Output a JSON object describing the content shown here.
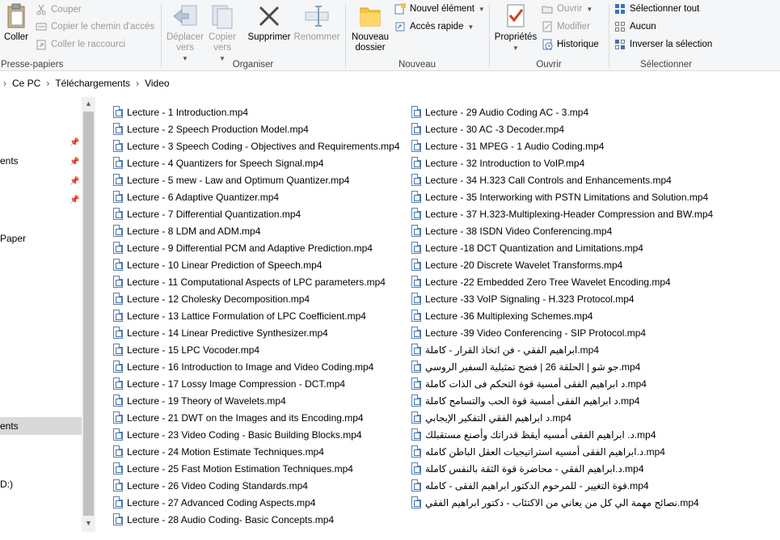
{
  "ribbon": {
    "clipboard": {
      "label": "Presse-papiers",
      "paste": "Coller",
      "cut": "Couper",
      "copy_path": "Copier le chemin d'accès",
      "paste_shortcut": "Coller le raccourci"
    },
    "organize": {
      "label": "Organiser",
      "move_to": "Déplacer vers",
      "copy_to": "Copier vers",
      "delete": "Supprimer",
      "rename": "Renommer"
    },
    "new": {
      "label": "Nouveau",
      "new_folder": "Nouveau dossier",
      "new_item": "Nouvel élément",
      "easy_access": "Accès rapide"
    },
    "open": {
      "label": "Ouvrir",
      "properties": "Propriétés",
      "open": "Ouvrir",
      "edit": "Modifier",
      "history": "Historique"
    },
    "select": {
      "label": "Sélectionner",
      "select_all": "Sélectionner tout",
      "select_none": "Aucun",
      "invert": "Inverser la sélection"
    }
  },
  "address": {
    "crumbs": [
      "Ce PC",
      "Téléchargements",
      "Video"
    ]
  },
  "nav": {
    "items": [
      "ents",
      "Paper",
      "ents",
      "D:)"
    ]
  },
  "files": {
    "left": [
      "Lecture - 1 Introduction.mp4",
      "Lecture - 2 Speech Production Model.mp4",
      "Lecture - 3 Speech Coding - Objectives and Requirements.mp4",
      "Lecture - 4 Quantizers for Speech Signal.mp4",
      "Lecture - 5 mew - Law and Optimum Quantizer.mp4",
      "Lecture - 6 Adaptive Quantizer.mp4",
      "Lecture - 7 Differential Quantization.mp4",
      "Lecture - 8 LDM and ADM.mp4",
      "Lecture - 9 Differential PCM and Adaptive Prediction.mp4",
      "Lecture - 10 Linear Prediction of Speech.mp4",
      "Lecture - 11 Computational Aspects of LPC parameters.mp4",
      "Lecture - 12 Cholesky Decomposition.mp4",
      "Lecture - 13 Lattice Formulation of LPC Coefficient.mp4",
      "Lecture - 14 Linear Predictive Synthesizer.mp4",
      "Lecture - 15 LPC Vocoder.mp4",
      "Lecture - 16 Introduction to Image and Video Coding.mp4",
      "Lecture - 17 Lossy Image Compression - DCT.mp4",
      "Lecture - 19 Theory of Wavelets.mp4",
      "Lecture - 21 DWT on the Images and its Encoding.mp4",
      "Lecture - 23 Video Coding - Basic Building Blocks.mp4",
      "Lecture - 24 Motion Estimate Techniques.mp4",
      "Lecture - 25 Fast Motion Estimation Techniques.mp4",
      "Lecture - 26 Video Coding Standards.mp4",
      "Lecture - 27 Advanced Coding Aspects.mp4",
      "Lecture - 28 Audio Coding- Basic Concepts.mp4"
    ],
    "right": [
      "Lecture - 29 Audio Coding AC - 3.mp4",
      "Lecture - 30 AC -3 Decoder.mp4",
      "Lecture - 31 MPEG - 1 Audio Coding.mp4",
      "Lecture - 32 Introduction to VoIP.mp4",
      "Lecture - 34 H.323 Call Controls and Enhancements.mp4",
      "Lecture - 35 Interworking with PSTN Limitations and Solution.mp4",
      "Lecture - 37 H.323-Multiplexing-Header Compression and BW.mp4",
      "Lecture - 38 ISDN Video Conferencing.mp4",
      "Lecture -18 DCT Quantization and Limitations.mp4",
      "Lecture -20 Discrete Wavelet Transforms.mp4",
      "Lecture -22 Embedded Zero Tree Wavelet Encoding.mp4",
      "Lecture -33 VoIP Signaling - H.323 Protocol.mp4",
      "Lecture -36 Multiplexing Schemes.mp4",
      "Lecture -39 Video Conferencing - SIP Protocol.mp4",
      "ابراهيم الفقي - فن اتخاذ القرار - كاملة.mp4",
      "جو شو | الحلقة 26 | فضح تمثيلية السفير الروسي.mp4",
      "د ابراهيم الفقى أمسية قوة التحكم فى الذات كاملة.mp4",
      "د ابراهيم الفقى أمسية قوة الحب والتسامح كاملة.mp4",
      "د ابراهيم الفقي  التفكير الإيجابي.mp4",
      "د. ابراهيم الفقى أمسيه أيقظ قدراتك وأصنع مستقبلك.mp4",
      "د.ابراهيم الفقى أمسيه استراتيجيات العقل الباطن كامله.mp4",
      "د.ابراهيم الفقي - محاضرة قوة الثقة بالنفس كاملة.mp4",
      "قوة التغيير - للمرحوم الدكتور ابراهيم الفقى - كامله.mp4",
      "نصائح مهمة  الي كل من يعاني من الاكتئاب - دكتور ابراهيم الفقي.mp4"
    ]
  },
  "colors": {
    "ribbon_bg": "#f5f6f7",
    "selection": "#d9d9d9",
    "accent_blue": "#3b73b9"
  }
}
